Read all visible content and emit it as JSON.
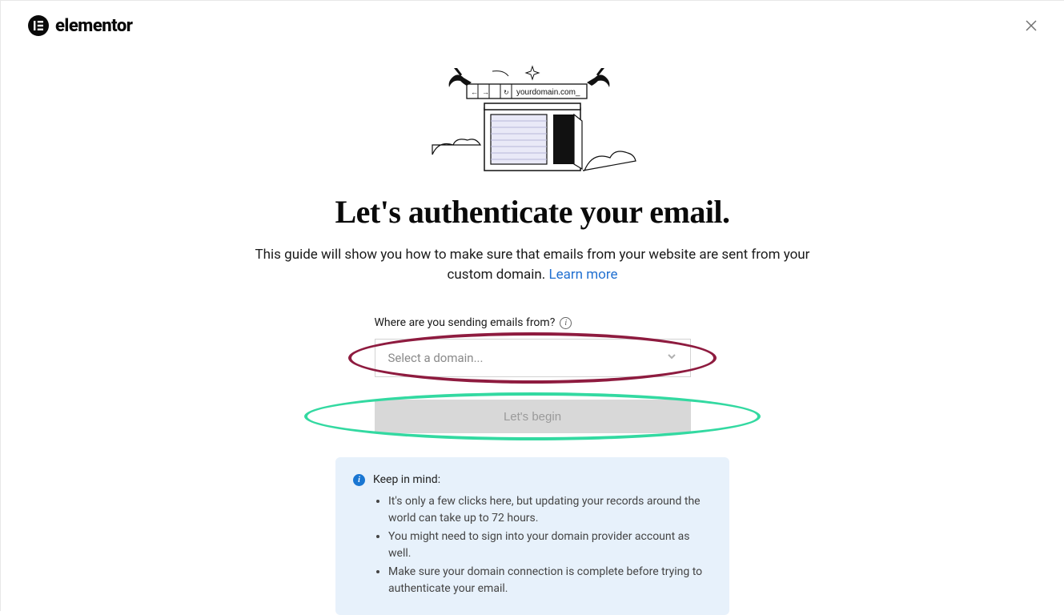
{
  "header": {
    "brand": "elementor"
  },
  "illustration": {
    "banner_text": "yourdomain.com_"
  },
  "main": {
    "title": "Let's authenticate your email.",
    "subtitle_a": "This guide will show you how to make sure that emails from your website are sent from your custom domain.  ",
    "learn_more": "Learn more"
  },
  "form": {
    "label": "Where are you sending emails from?",
    "select_placeholder": "Select a domain...",
    "begin_label": "Let's begin"
  },
  "note": {
    "heading": "Keep in mind:",
    "items": [
      "It's only a few clicks here, but updating your records around the world can take up to 72 hours.",
      "You might need to sign into your domain provider account as well.",
      "Make sure your domain connection is complete before trying to authenticate your email."
    ]
  }
}
